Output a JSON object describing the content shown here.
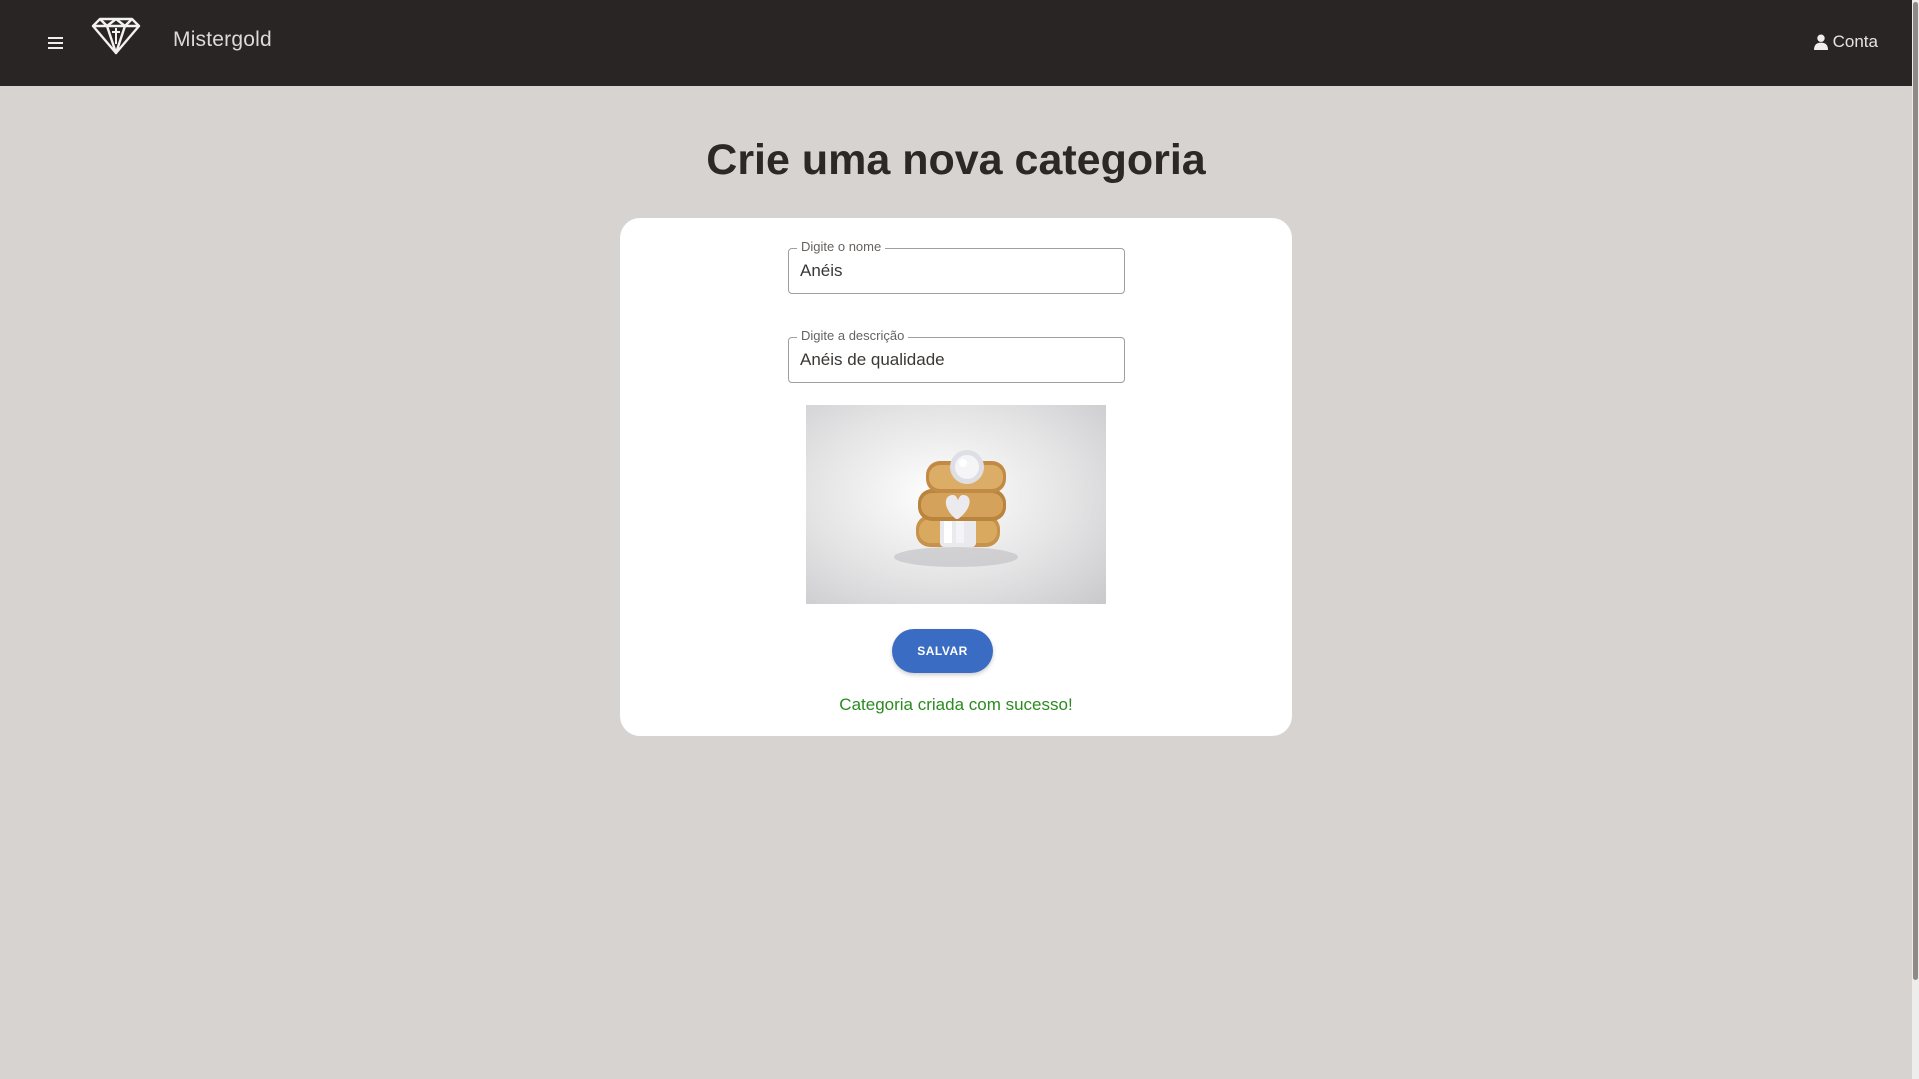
{
  "header": {
    "brand": "Mistergold",
    "account_label": "Conta",
    "menu_icon": "menu-icon",
    "logo_icon": "diamond-logo-icon",
    "account_icon": "user-icon"
  },
  "page": {
    "title": "Crie uma nova categoria"
  },
  "form": {
    "name_label": "Digite o nome",
    "name_value": "Anéis",
    "description_label": "Digite a descrição",
    "description_value": "Anéis de qualidade",
    "save_label": "SALVAR",
    "success_message": "Categoria criada com sucesso!"
  },
  "colors": {
    "header_bg": "#292524",
    "page_bg": "#d6d3d0",
    "button": "#3a6cc4",
    "success": "#2b8a20"
  }
}
